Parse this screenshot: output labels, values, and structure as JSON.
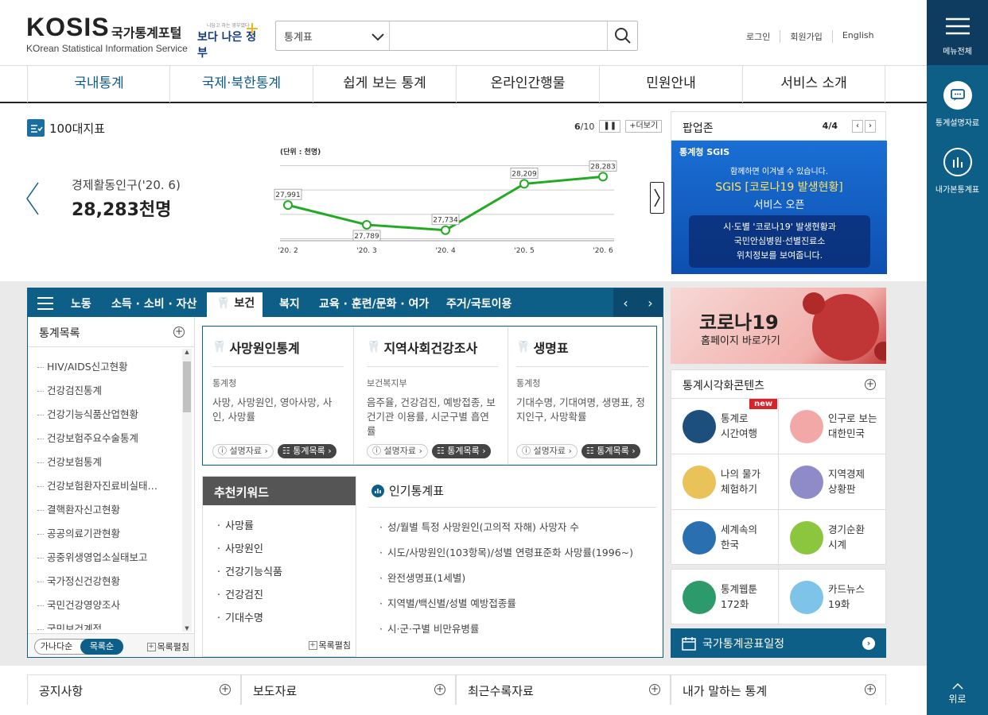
{
  "header": {
    "logo_main": "KOSIS",
    "logo_kr": "국가통계포털",
    "logo_en": "KOrean Statistical Information Service",
    "gov_slogan_small": "나답고 하는 영부였다",
    "gov_slogan": "보다 나은 정부",
    "search_select": "통계표",
    "search_placeholder": "",
    "util": [
      "로그인",
      "회원가입",
      "English"
    ]
  },
  "rail": {
    "menu": "메뉴전체",
    "explain": "통계설명자료",
    "my_stats": "내가본통계표",
    "top": "위로"
  },
  "nav": [
    "국내통계",
    "국제·북한통계",
    "쉽게 보는 통계",
    "온라인간행물",
    "민원안내",
    "서비스 소개"
  ],
  "indicator": {
    "section_title": "100대지표",
    "name": "경제활동인구('20. 6)",
    "value": "28,283천명",
    "pager_current": "6",
    "pager_total": "/10",
    "more": "+더보기"
  },
  "chart_data": {
    "type": "line",
    "unit_label": "(단위 : 천명)",
    "categories": [
      "'20. 2",
      "'20. 3",
      "'20. 4",
      "'20. 5",
      "'20. 6"
    ],
    "values": [
      27991,
      27789,
      27734,
      28209,
      28283
    ],
    "value_labels": [
      "27,991",
      "27,789",
      "27,734",
      "28,209",
      "28,283"
    ],
    "ylim": [
      27650,
      28400
    ],
    "color": "#22aa22",
    "grid": true
  },
  "popup_zone": {
    "title": "팝업존",
    "pager": "4/4",
    "brand": "통계청 SGIS",
    "banner_line1": "함께하면 이겨낼 수 있습니다.",
    "banner_line2": "SGIS [코로나19 발생현황]",
    "banner_line3": "서비스 오픈",
    "banner_box": [
      "시·도별 '코로나19' 발생현황과",
      "국민안심병원·선별진료소",
      "위치정보를 보여줍니다."
    ]
  },
  "tabs": [
    "노동",
    "소득 · 소비 · 자산",
    "보건",
    "복지",
    "교육 · 훈련/문화 · 여가",
    "주거/국토이용"
  ],
  "stat_list": {
    "title": "통계목록",
    "items": [
      "HIV/AIDS신고현황",
      "건강검진통계",
      "건강기능식품산업현황",
      "건강보험주요수술통계",
      "건강보험통계",
      "건강보험환자진료비실태…",
      "결핵환자신고현황",
      "공공의료기관현황",
      "공중위생영업소실태보고",
      "국가정신건강현황",
      "국민건강영양조사",
      "국민보건계정"
    ],
    "sort_a": "가나다순",
    "sort_b": "목록순",
    "expand": "목록펼침"
  },
  "cards": [
    {
      "title": "사망원인통계",
      "org": "통계청",
      "desc": "사망, 사망원인, 영아사망, 사인, 사망률",
      "btn1": "설명자료",
      "btn2": "통계목록"
    },
    {
      "title": "지역사회건강조사",
      "org": "보건복지부",
      "desc": "음주율, 건강검진, 예방접종, 보건기관 이용률, 시군구별 흡연률",
      "btn1": "설명자료",
      "btn2": "통계목록"
    },
    {
      "title": "생명표",
      "org": "통계청",
      "desc": "기대수명, 기대여명, 생명표, 정지인구, 사망확률",
      "btn1": "설명자료",
      "btn2": "통계목록"
    }
  ],
  "keywords": {
    "title": "추천키워드",
    "items": [
      "사망률",
      "사망원인",
      "건강기능식품",
      "건강검진",
      "기대수명"
    ],
    "expand": "목록펼침"
  },
  "popular": {
    "title": "인기통계표",
    "items": [
      "성/월별 특정 사망원인(고의적 자해) 사망자 수",
      "시도/사망원인(103항목)/성별 연령표준화 사망률(1996~)",
      "완전생명표(1세별)",
      "지역별/백신별/성별 예방접종률",
      "시·군·구별 비만유병률"
    ]
  },
  "covid_banner": {
    "line1": "코로나19",
    "line2": "홈페이지 바로가기"
  },
  "visual": {
    "title": "통계시각화콘텐츠",
    "new_badge": "new",
    "items": [
      {
        "l1": "통계로",
        "l2": "시간여행"
      },
      {
        "l1": "인구로 보는",
        "l2": "대한민국"
      },
      {
        "l1": "나의 물가",
        "l2": "체험하기"
      },
      {
        "l1": "지역경제",
        "l2": "상황판"
      },
      {
        "l1": "세계속의",
        "l2": "한국"
      },
      {
        "l1": "경기순환",
        "l2": "시계"
      }
    ]
  },
  "cards2": [
    {
      "l1": "통계웹툰",
      "l2": "172화"
    },
    {
      "l1": "카드뉴스",
      "l2": "19화"
    }
  ],
  "schedule": "국가통계공표일정",
  "boards": [
    "공지사항",
    "보도자료",
    "최근수록자료",
    "내가 말하는 통계"
  ]
}
